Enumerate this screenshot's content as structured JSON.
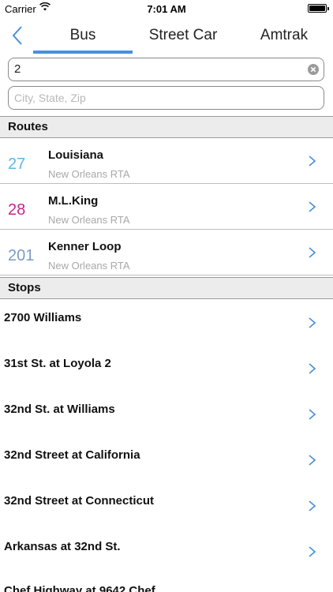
{
  "status_bar": {
    "carrier": "Carrier",
    "time": "7:01 AM"
  },
  "tabs": [
    {
      "label": "Bus",
      "selected": true
    },
    {
      "label": "Street Car",
      "selected": false
    },
    {
      "label": "Amtrak",
      "selected": false
    }
  ],
  "search": {
    "value": "2"
  },
  "location": {
    "placeholder": "City, State, Zip"
  },
  "routes_section": {
    "title": "Routes",
    "items": [
      {
        "number": "27",
        "name": "Louisiana",
        "agency": "New Orleans RTA",
        "color": "#5bb8e8"
      },
      {
        "number": "28",
        "name": "M.L.King",
        "agency": "New Orleans RTA",
        "color": "#c8258e"
      },
      {
        "number": "201",
        "name": "Kenner Loop",
        "agency": "New Orleans RTA",
        "color": "#7a9cc6"
      }
    ]
  },
  "stops_section": {
    "title": "Stops",
    "items": [
      "2700 Williams",
      "31st St. at Loyola 2",
      "32nd St. at Williams",
      "32nd Street at California",
      "32nd Street at Connecticut",
      "Arkansas at 32nd St.",
      "Chef Highway at 9642 Chef"
    ]
  },
  "colors": {
    "accent": "#4a90d9"
  }
}
